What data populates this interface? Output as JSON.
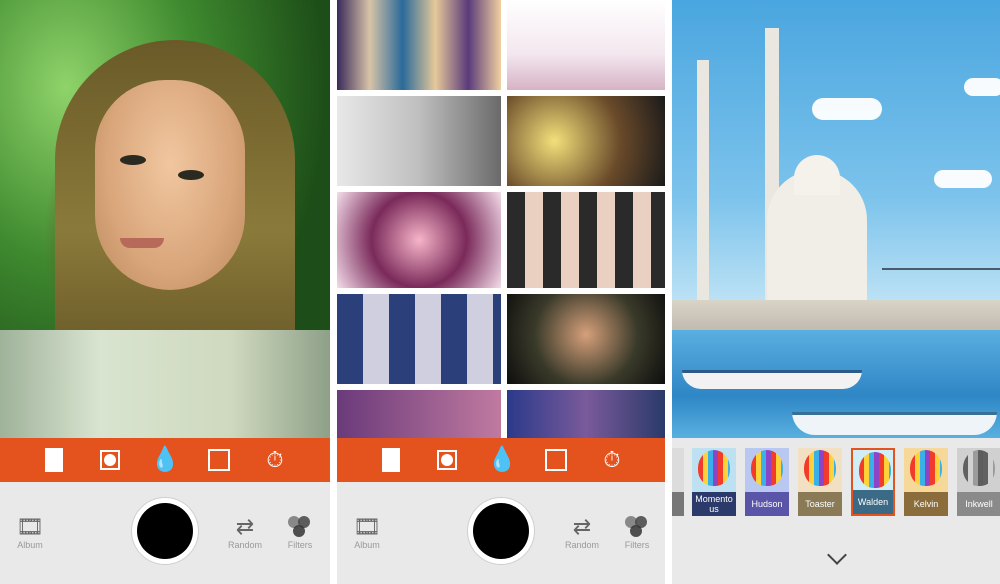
{
  "screen1": {
    "toolbar": {
      "icons": [
        "frame-icon",
        "circle-mask-icon",
        "drop-icon",
        "square-icon",
        "timer-icon"
      ]
    },
    "bottom": {
      "album_label": "Album",
      "random_label": "Random",
      "filters_label": "Filters"
    }
  },
  "screen2": {
    "toolbar": {
      "icons": [
        "frame-icon",
        "circle-mask-icon",
        "drop-icon",
        "square-icon",
        "timer-icon"
      ]
    },
    "bottom": {
      "album_label": "Album",
      "random_label": "Random",
      "filters_label": "Filters"
    }
  },
  "screen3": {
    "filters": [
      {
        "label": ""
      },
      {
        "label": "Momento us"
      },
      {
        "label": "Hudson"
      },
      {
        "label": "Toaster"
      },
      {
        "label": "Walden"
      },
      {
        "label": "Kelvin"
      },
      {
        "label": "Inkwell"
      }
    ],
    "selected_filter": "Walden"
  },
  "colors": {
    "accent": "#e4521e",
    "bottom_bar": "#e9e9e9",
    "momentous": "#2b3a6a",
    "hudson": "#5a55a8",
    "toaster": "#8a7a55",
    "walden": "#3b6a86",
    "kelvin": "#8a6d3a",
    "inkwell": "#8a8a8a"
  }
}
